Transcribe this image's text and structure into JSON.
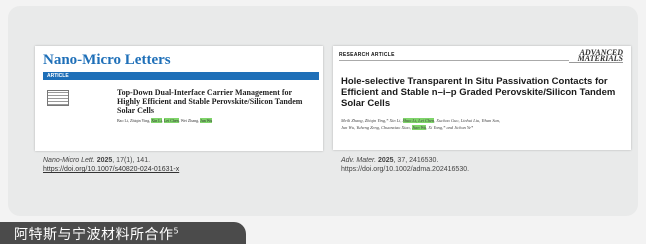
{
  "paper1": {
    "journal": "Nano-Micro Letters",
    "section": "ARTICLE",
    "title": "Top-Down Dual-Interface Carrier Management for Highly Efficient and Stable Perovskite/Silicon Tandem Solar Cells",
    "authors": [
      "Bao Li",
      "Zhiqin Ying",
      "Xin Li",
      "Lei Chen",
      "Wei Zhang"
    ],
    "highlighted_authors": [
      "Xin Li",
      "Lei Chen",
      "Jun Wu"
    ],
    "citation_journal": "Nano-Micro Lett.",
    "citation_year": "2025",
    "citation_rest": ", 17(1), 141.",
    "doi": "https://doi.org/10.1007/s40820-024-01631-x"
  },
  "paper2": {
    "type_label": "RESEARCH ARTICLE",
    "publisher_logo": "ADVANCED MATERIALS",
    "title": "Hole-selective Transparent In Situ Passivation Contacts for Efficient and Stable n–i–p Graded Perovskite/Silicon Tandem Solar Cells",
    "authors_line_1_pre": "Meili Zhang, Zhiqin Ying,* Xin Li, ",
    "authors_hl_1": "Shuo Li, Lei Chen",
    "authors_line_1_post": ", Xuchao Guo, Linhui Liu, Yihan Sun,",
    "authors_line_2_pre": "Jun Wu, Yuheng Zeng, Chuanxiao Xiao, ",
    "authors_hl_2": "Jian Wu",
    "authors_line_2_post": ", Xi Yang,* and Jichun Ye*",
    "citation_journal": "Adv. Mater.",
    "citation_year": "2025",
    "citation_rest": ", 37, 2416530.",
    "doi": "https://doi.org/10.1002/adma.202416530."
  },
  "banner": {
    "text": "阿特斯与宁波材料所合作",
    "superscript": "5"
  }
}
